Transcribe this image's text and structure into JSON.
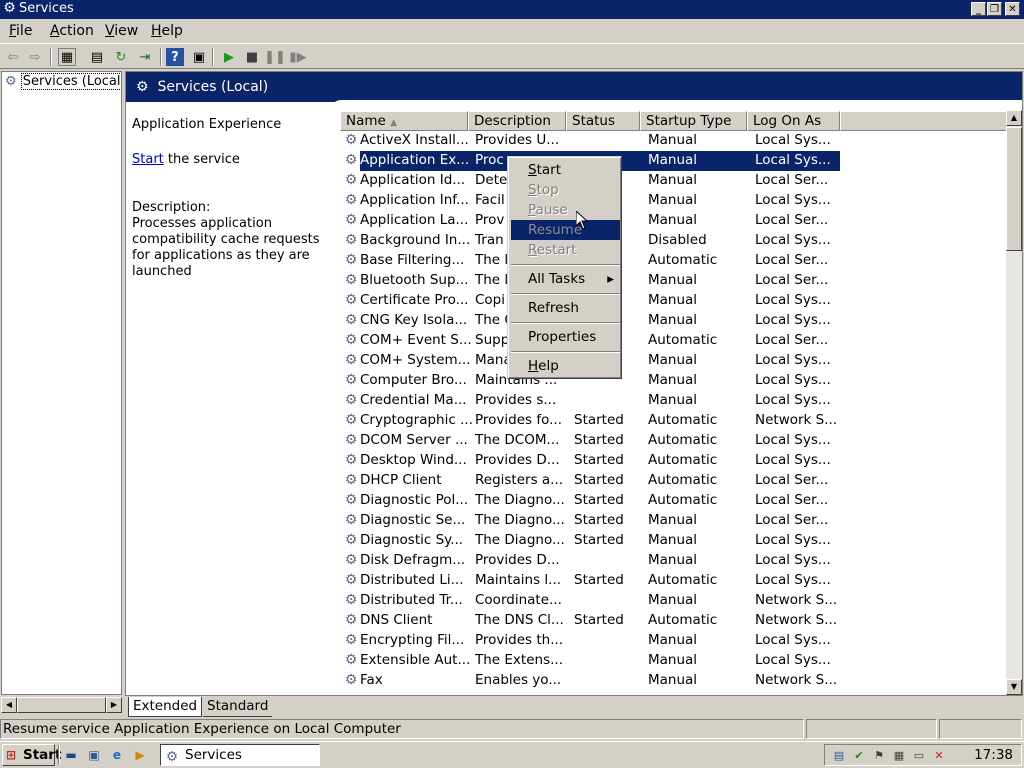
{
  "window": {
    "title": "Services",
    "min": "_",
    "max": "❐",
    "close": "✕"
  },
  "menu": [
    {
      "label": "File",
      "key": "F",
      "rest": "ile"
    },
    {
      "label": "Action",
      "key": "A",
      "rest": "ction"
    },
    {
      "label": "View",
      "key": "V",
      "rest": "iew"
    },
    {
      "label": "Help",
      "key": "H",
      "rest": "elp"
    }
  ],
  "tree": {
    "root": "Services (Local)"
  },
  "pane": {
    "header": "Services (Local)",
    "selected_name": "Application Experience",
    "start_link": "Start",
    "start_rest": " the service",
    "desc_label": "Description:",
    "desc_text": [
      "Processes application",
      "compatibility cache requests",
      "for applications as they are",
      "launched"
    ]
  },
  "columns": [
    "Name",
    "Description",
    "Status",
    "Startup Type",
    "Log On As"
  ],
  "services": [
    [
      "ActiveX Install...",
      "Provides U...",
      "",
      "Manual",
      "Local Sys..."
    ],
    [
      "Application Ex...",
      "Proc",
      "",
      "Manual",
      "Local Sys..."
    ],
    [
      "Application Id...",
      "Dete",
      "",
      "Manual",
      "Local Ser..."
    ],
    [
      "Application Inf...",
      "Facil",
      "",
      "Manual",
      "Local Sys..."
    ],
    [
      "Application La...",
      "Prov",
      "",
      "Manual",
      "Local Ser..."
    ],
    [
      "Background In...",
      "Tran",
      "",
      "Disabled",
      "Local Sys..."
    ],
    [
      "Base Filtering...",
      "The l",
      "",
      "Automatic",
      "Local Ser..."
    ],
    [
      "Bluetooth Sup...",
      "The l",
      "",
      "Manual",
      "Local Ser..."
    ],
    [
      "Certificate Pro...",
      "Copi",
      "",
      "Manual",
      "Local Sys..."
    ],
    [
      "CNG Key Isola...",
      "The C",
      "",
      "Manual",
      "Local Sys..."
    ],
    [
      "COM+ Event S...",
      "Supp",
      "",
      "Automatic",
      "Local Ser..."
    ],
    [
      "COM+ System...",
      "Mana",
      "",
      "Manual",
      "Local Sys..."
    ],
    [
      "Computer Bro...",
      "Maintains ...",
      "",
      "Manual",
      "Local Sys..."
    ],
    [
      "Credential Ma...",
      "Provides s...",
      "",
      "Manual",
      "Local Sys..."
    ],
    [
      "Cryptographic ...",
      "Provides fo...",
      "Started",
      "Automatic",
      "Network S..."
    ],
    [
      "DCOM Server ...",
      "The DCOM...",
      "Started",
      "Automatic",
      "Local Sys..."
    ],
    [
      "Desktop Wind...",
      "Provides D...",
      "Started",
      "Automatic",
      "Local Sys..."
    ],
    [
      "DHCP Client",
      "Registers a...",
      "Started",
      "Automatic",
      "Local Ser..."
    ],
    [
      "Diagnostic Pol...",
      "The Diagno...",
      "Started",
      "Automatic",
      "Local Ser..."
    ],
    [
      "Diagnostic Se...",
      "The Diagno...",
      "Started",
      "Manual",
      "Local Ser..."
    ],
    [
      "Diagnostic Sy...",
      "The Diagno...",
      "Started",
      "Manual",
      "Local Sys..."
    ],
    [
      "Disk Defragm...",
      "Provides D...",
      "",
      "Manual",
      "Local Sys..."
    ],
    [
      "Distributed Li...",
      "Maintains l...",
      "Started",
      "Automatic",
      "Local Sys..."
    ],
    [
      "Distributed Tr...",
      "Coordinate...",
      "",
      "Manual",
      "Network S..."
    ],
    [
      "DNS Client",
      "The DNS Cl...",
      "Started",
      "Automatic",
      "Network S..."
    ],
    [
      "Encrypting Fil...",
      "Provides th...",
      "",
      "Manual",
      "Local Sys..."
    ],
    [
      "Extensible Aut...",
      "The Extens...",
      "",
      "Manual",
      "Local Sys..."
    ],
    [
      "Fax",
      "Enables yo...",
      "",
      "Manual",
      "Network S..."
    ]
  ],
  "context_menu": [
    {
      "type": "item",
      "key": "S",
      "rest": "tart",
      "disabled": false
    },
    {
      "type": "item",
      "key": "S",
      "rest": "top",
      "disabled": true
    },
    {
      "type": "item",
      "key": "P",
      "rest": "ause",
      "disabled": true
    },
    {
      "type": "item",
      "key": "",
      "rest": "Resume",
      "disabled": true,
      "highlight": true
    },
    {
      "type": "item",
      "key": "R",
      "rest": "estart",
      "disabled": true
    },
    {
      "type": "sep"
    },
    {
      "type": "item",
      "key": "",
      "rest": "All Tasks",
      "disabled": false,
      "submenu": true
    },
    {
      "type": "sep"
    },
    {
      "type": "item",
      "key": "",
      "rest": "Refresh",
      "disabled": false
    },
    {
      "type": "sep"
    },
    {
      "type": "item",
      "key": "",
      "rest": "Properties",
      "disabled": false
    },
    {
      "type": "sep"
    },
    {
      "type": "item",
      "key": "H",
      "rest": "elp",
      "disabled": false
    }
  ],
  "tabs": [
    "Extended",
    "Standard"
  ],
  "status": {
    "text": "Resume service Application Experience on Local Computer"
  },
  "taskbar": {
    "start": "Start",
    "task": "Services",
    "clock": "17:38"
  },
  "colors": {
    "titlebar": "#0a246a",
    "face": "#d4d0c8",
    "selection": "#0a246a"
  }
}
